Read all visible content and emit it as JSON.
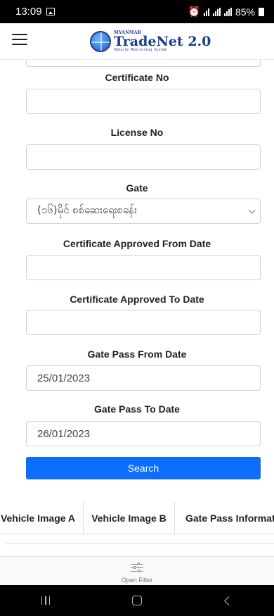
{
  "status_bar": {
    "time": "13:09",
    "battery": "85%"
  },
  "header": {
    "logo_top": "MYANMAR",
    "logo_main": "TradeNet",
    "logo_version": "2.0",
    "logo_sub": "Vehicle Monitoring System"
  },
  "form": {
    "certificate_no_label": "Certificate No",
    "certificate_no_value": "",
    "license_no_label": "License No",
    "license_no_value": "",
    "gate_label": "Gate",
    "gate_value": "(၁၆)မိုင် စစ်ဆေးရေးစခန်း",
    "cert_from_label": "Certificate Approved From Date",
    "cert_from_value": "",
    "cert_to_label": "Certificate Approved To Date",
    "cert_to_value": "",
    "gate_pass_from_label": "Gate Pass From Date",
    "gate_pass_from_value": "25/01/2023",
    "gate_pass_to_label": "Gate Pass To Date",
    "gate_pass_to_value": "26/01/2023",
    "search_label": "Search"
  },
  "table": {
    "columns": [
      "Vehicle Image A",
      "Vehicle Image B",
      "Gate Pass Information"
    ]
  },
  "filter": {
    "label": "Open Filter"
  },
  "colors": {
    "primary": "#0d6efd",
    "brand": "#1a3e8a"
  }
}
